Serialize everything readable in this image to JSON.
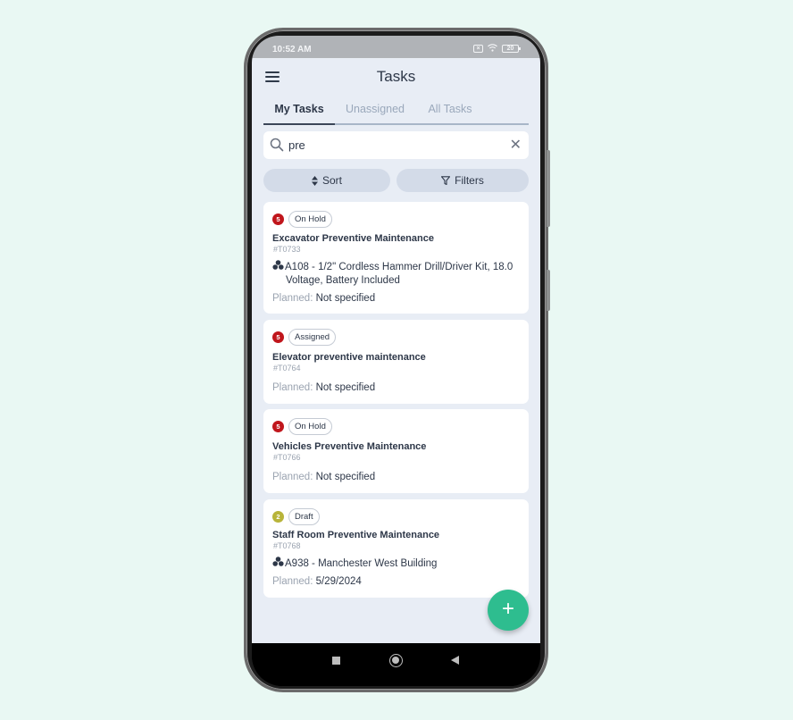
{
  "status_bar": {
    "time": "10:52 AM",
    "battery": "20",
    "icons": [
      "sim-off-icon",
      "wifi-icon",
      "battery-icon"
    ]
  },
  "header": {
    "title": "Tasks",
    "menu_icon": "hamburger-menu-icon"
  },
  "tabs": [
    {
      "label": "My Tasks",
      "active": true
    },
    {
      "label": "Unassigned",
      "active": false
    },
    {
      "label": "All Tasks",
      "active": false
    }
  ],
  "search": {
    "value": "pre",
    "icon": "search-icon",
    "clear_icon": "close-icon"
  },
  "toolbar": {
    "sort_label": "Sort",
    "filter_label": "Filters"
  },
  "colors": {
    "priority_high": "#c0161c",
    "priority_medium": "#b8b43a",
    "fab": "#2ebd8f",
    "active_tab": "#2d3748",
    "inactive_tab": "#9aa8bb"
  },
  "tasks": [
    {
      "priority": "5",
      "status": "On Hold",
      "name": "Excavator Preventive Maintenance",
      "code": "#T0733",
      "asset_line1": "A108 - 1/2\" Cordless Hammer Drill/Driver Kit, 18.0",
      "asset_line2": "Voltage, Battery Included",
      "planned_label": "Planned:",
      "planned_value": "Not specified"
    },
    {
      "priority": "5",
      "status": "Assigned",
      "name": "Elevator preventive maintenance",
      "code": "#T0764",
      "planned_label": "Planned:",
      "planned_value": "Not specified"
    },
    {
      "priority": "5",
      "status": "On Hold",
      "name": "Vehicles Preventive Maintenance",
      "code": "#T0766",
      "planned_label": "Planned:",
      "planned_value": "Not specified"
    },
    {
      "priority": "2",
      "status": "Draft",
      "name": "Staff Room Preventive Maintenance",
      "code": "#T0768",
      "asset_line1": "A938 - Manchester West Building",
      "planned_label": "Planned:",
      "planned_value": "5/29/2024"
    }
  ],
  "fab": {
    "label": "+",
    "icon": "add-icon"
  },
  "nav": [
    "recents-icon",
    "home-icon",
    "back-icon"
  ]
}
